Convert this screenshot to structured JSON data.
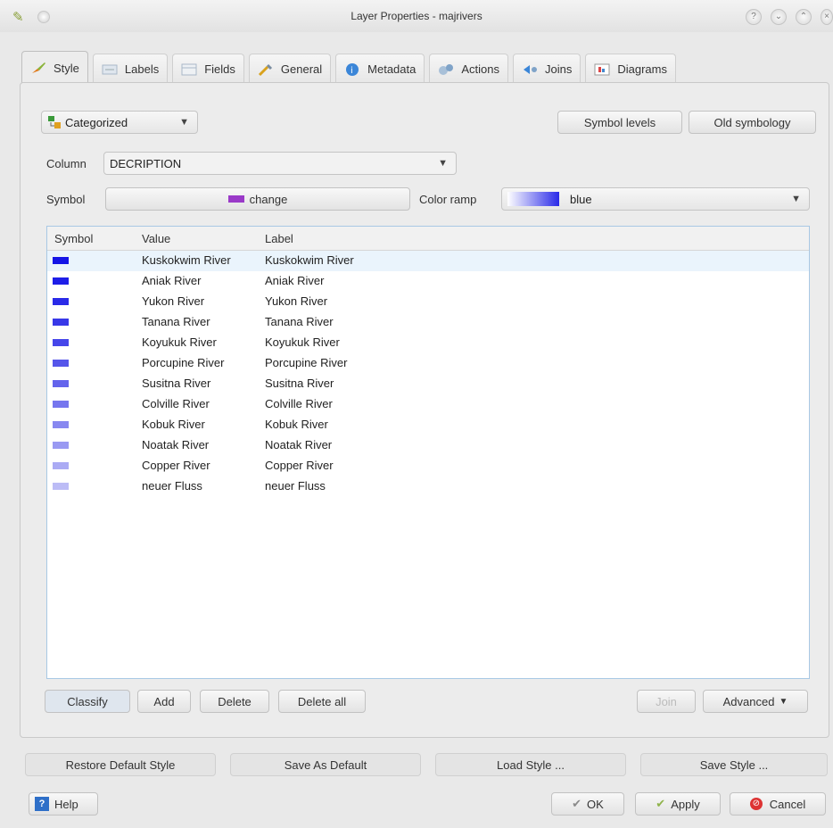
{
  "window": {
    "title": "Layer Properties - majrivers"
  },
  "tabs": [
    {
      "label": "Style",
      "icon": "brush-icon"
    },
    {
      "label": "Labels",
      "icon": "labels-icon"
    },
    {
      "label": "Fields",
      "icon": "fields-icon"
    },
    {
      "label": "General",
      "icon": "tools-icon"
    },
    {
      "label": "Metadata",
      "icon": "info-icon"
    },
    {
      "label": "Actions",
      "icon": "actions-icon"
    },
    {
      "label": "Joins",
      "icon": "joins-icon"
    },
    {
      "label": "Diagrams",
      "icon": "diagram-icon"
    }
  ],
  "style": {
    "renderer": "Categorized",
    "symbol_levels": "Symbol levels",
    "old_symbology": "Old symbology",
    "column_label": "Column",
    "column_value": "DECRIPTION",
    "symbol_label": "Symbol",
    "symbol_button": "change",
    "color_ramp_label": "Color ramp",
    "color_ramp_value": "blue"
  },
  "table": {
    "headers": {
      "symbol": "Symbol",
      "value": "Value",
      "label": "Label"
    },
    "rows": [
      {
        "value": "Kuskokwim River",
        "label": "Kuskokwim River",
        "color": "#1414e6"
      },
      {
        "value": "Aniak River",
        "label": "Aniak River",
        "color": "#1e1ee8"
      },
      {
        "value": "Yukon River",
        "label": "Yukon River",
        "color": "#2a2ae8"
      },
      {
        "value": "Tanana River",
        "label": "Tanana River",
        "color": "#3838e8"
      },
      {
        "value": "Koyukuk River",
        "label": "Koyukuk River",
        "color": "#4646ea"
      },
      {
        "value": "Porcupine River",
        "label": "Porcupine River",
        "color": "#5656ea"
      },
      {
        "value": "Susitna River",
        "label": "Susitna River",
        "color": "#6464ec"
      },
      {
        "value": "Colville River",
        "label": "Colville River",
        "color": "#7676ee"
      },
      {
        "value": "Kobuk River",
        "label": "Kobuk River",
        "color": "#8888f0"
      },
      {
        "value": "Noatak River",
        "label": "Noatak River",
        "color": "#9a9af2"
      },
      {
        "value": "Copper River",
        "label": "Copper River",
        "color": "#ababf4"
      },
      {
        "value": "neuer Fluss",
        "label": "neuer Fluss",
        "color": "#bcbcf6"
      }
    ]
  },
  "table_buttons": {
    "classify": "Classify",
    "add": "Add",
    "delete": "Delete",
    "delete_all": "Delete all",
    "join": "Join",
    "advanced": "Advanced"
  },
  "footer": {
    "restore": "Restore Default Style",
    "save_default": "Save As Default",
    "load": "Load Style ...",
    "save": "Save Style ...",
    "help": "Help",
    "ok": "OK",
    "apply": "Apply",
    "cancel": "Cancel"
  }
}
